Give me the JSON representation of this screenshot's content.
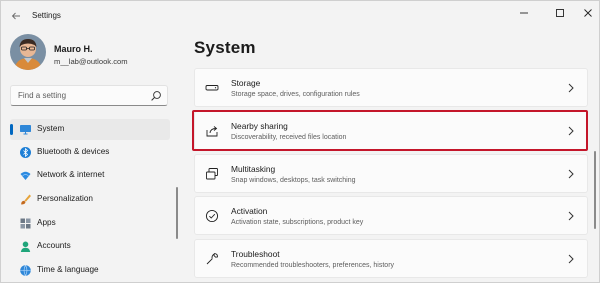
{
  "window": {
    "title": "Settings",
    "back_icon": "back-arrow-icon",
    "controls": [
      "minimize",
      "maximize",
      "close"
    ],
    "close_glyph": "✕",
    "minimize_glyph": "—"
  },
  "profile": {
    "name": "Mauro H.",
    "email": "m__lab@outlook.com"
  },
  "search": {
    "placeholder": "Find a setting"
  },
  "sidebar": {
    "items": [
      {
        "label": "System",
        "icon": "monitor-icon",
        "selected": true
      },
      {
        "label": "Bluetooth & devices",
        "icon": "bluetooth-icon",
        "selected": false
      },
      {
        "label": "Network & internet",
        "icon": "wifi-icon",
        "selected": false
      },
      {
        "label": "Personalization",
        "icon": "brush-icon",
        "selected": false
      },
      {
        "label": "Apps",
        "icon": "apps-icon",
        "selected": false
      },
      {
        "label": "Accounts",
        "icon": "account-icon",
        "selected": false
      },
      {
        "label": "Time & language",
        "icon": "globe-icon",
        "selected": false
      }
    ]
  },
  "main": {
    "title": "System",
    "cards": [
      {
        "title": "Storage",
        "subtitle": "Storage space, drives, configuration rules",
        "icon": "storage-icon"
      },
      {
        "title": "Nearby sharing",
        "subtitle": "Discoverability, received files location",
        "icon": "share-icon",
        "highlighted": true
      },
      {
        "title": "Multitasking",
        "subtitle": "Snap windows, desktops, task switching",
        "icon": "multitasking-icon"
      },
      {
        "title": "Activation",
        "subtitle": "Activation state, subscriptions, product key",
        "icon": "activation-check-icon"
      },
      {
        "title": "Troubleshoot",
        "subtitle": "Recommended troubleshooters, preferences, history",
        "icon": "wrench-icon"
      }
    ]
  },
  "colors": {
    "accent": "#0067c0",
    "highlight_border": "#c4162a",
    "window_bg": "#f3f3f3",
    "card_bg": "#fbfbfb"
  }
}
